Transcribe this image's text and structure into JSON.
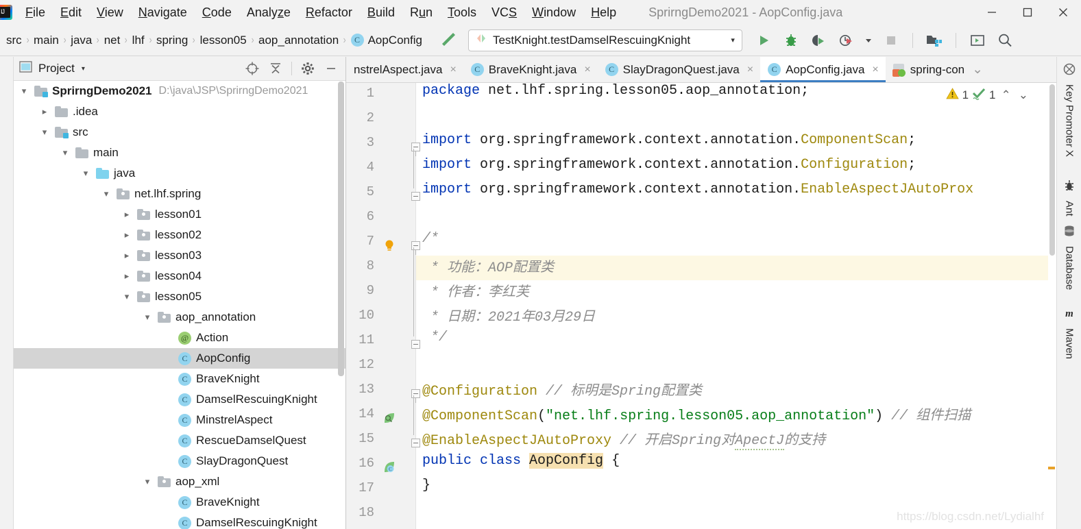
{
  "window": {
    "title": "SprirngDemo2021 - AopConfig.java",
    "controls": {
      "minimize": "minimize-icon",
      "maximize": "maximize-icon",
      "close": "close-icon"
    }
  },
  "menubar": {
    "items": [
      {
        "label": "File",
        "mnemonic": "F"
      },
      {
        "label": "Edit",
        "mnemonic": "E"
      },
      {
        "label": "View",
        "mnemonic": "V"
      },
      {
        "label": "Navigate",
        "mnemonic": "N"
      },
      {
        "label": "Code",
        "mnemonic": "C"
      },
      {
        "label": "Analyze",
        "mnemonic": "z"
      },
      {
        "label": "Refactor",
        "mnemonic": "R"
      },
      {
        "label": "Build",
        "mnemonic": "B"
      },
      {
        "label": "Run",
        "mnemonic": "u"
      },
      {
        "label": "Tools",
        "mnemonic": "T"
      },
      {
        "label": "VCS",
        "mnemonic": "S"
      },
      {
        "label": "Window",
        "mnemonic": "W"
      },
      {
        "label": "Help",
        "mnemonic": "H"
      }
    ]
  },
  "navbar": {
    "breadcrumbs": [
      "src",
      "main",
      "java",
      "net",
      "lhf",
      "spring",
      "lesson05",
      "aop_annotation"
    ],
    "breadcrumb_final": "AopConfig",
    "breadcrumb_final_icon": "class-icon",
    "separator": "›",
    "make_project_icon": "hammer-icon",
    "run_config": {
      "label": "TestKnight.testDamselRescuingKnight",
      "icon": "run-config-icon",
      "caret": "▾"
    },
    "toolbar_buttons": [
      {
        "name": "run-button",
        "icon": "play-icon"
      },
      {
        "name": "debug-button",
        "icon": "bug-icon"
      },
      {
        "name": "run-with-coverage-button",
        "icon": "coverage-icon"
      },
      {
        "name": "profiler-button",
        "icon": "profiler-icon"
      },
      {
        "name": "stop-button",
        "icon": "stop-icon"
      },
      {
        "name": "project-structure-button",
        "icon": "project-structure-icon"
      },
      {
        "name": "terminal-button",
        "icon": "terminal-icon"
      },
      {
        "name": "search-everywhere-button",
        "icon": "search-icon"
      }
    ]
  },
  "project_panel": {
    "title": "Project",
    "caret": "▾",
    "tools": [
      {
        "name": "select-opened-file-button",
        "icon": "target-icon"
      },
      {
        "name": "collapse-all-button",
        "icon": "collapse-all-icon"
      },
      {
        "name": "settings-button",
        "icon": "gear-icon"
      },
      {
        "name": "hide-button",
        "icon": "minimize-icon"
      }
    ],
    "tree": [
      {
        "indent": 0,
        "arrow": "down",
        "icon": "module-folder",
        "label": "SprirngDemo2021",
        "bold": true,
        "hint": "D:\\java\\JSP\\SprirngDemo2021"
      },
      {
        "indent": 1,
        "arrow": "right",
        "icon": "folder",
        "label": ".idea"
      },
      {
        "indent": 1,
        "arrow": "down",
        "icon": "source-folder",
        "label": "src"
      },
      {
        "indent": 2,
        "arrow": "down",
        "icon": "folder",
        "label": "main"
      },
      {
        "indent": 3,
        "arrow": "down",
        "icon": "java-folder",
        "label": "java"
      },
      {
        "indent": 4,
        "arrow": "down",
        "icon": "package",
        "label": "net.lhf.spring"
      },
      {
        "indent": 5,
        "arrow": "right",
        "icon": "package",
        "label": "lesson01"
      },
      {
        "indent": 5,
        "arrow": "right",
        "icon": "package",
        "label": "lesson02"
      },
      {
        "indent": 5,
        "arrow": "right",
        "icon": "package",
        "label": "lesson03"
      },
      {
        "indent": 5,
        "arrow": "right",
        "icon": "package",
        "label": "lesson04"
      },
      {
        "indent": 5,
        "arrow": "down",
        "icon": "package",
        "label": "lesson05"
      },
      {
        "indent": 6,
        "arrow": "down",
        "icon": "package",
        "label": "aop_annotation"
      },
      {
        "indent": 7,
        "arrow": "none",
        "icon": "annotation",
        "label": "Action"
      },
      {
        "indent": 7,
        "arrow": "none",
        "icon": "class",
        "label": "AopConfig",
        "selected": true
      },
      {
        "indent": 7,
        "arrow": "none",
        "icon": "class",
        "label": "BraveKnight"
      },
      {
        "indent": 7,
        "arrow": "none",
        "icon": "class",
        "label": "DamselRescuingKnight"
      },
      {
        "indent": 7,
        "arrow": "none",
        "icon": "class",
        "label": "MinstrelAspect"
      },
      {
        "indent": 7,
        "arrow": "none",
        "icon": "class",
        "label": "RescueDamselQuest"
      },
      {
        "indent": 7,
        "arrow": "none",
        "icon": "class",
        "label": "SlayDragonQuest"
      },
      {
        "indent": 6,
        "arrow": "down",
        "icon": "package",
        "label": "aop_xml"
      },
      {
        "indent": 7,
        "arrow": "none",
        "icon": "class",
        "label": "BraveKnight"
      },
      {
        "indent": 7,
        "arrow": "none",
        "icon": "class",
        "label": "DamselRescuingKnight"
      }
    ]
  },
  "editor": {
    "tabs": [
      {
        "label": "nstrelAspect.java",
        "icon": "class-icon",
        "active": false,
        "truncated_left": true,
        "close": "×"
      },
      {
        "label": "BraveKnight.java",
        "icon": "class-icon",
        "active": false,
        "close": "×"
      },
      {
        "label": "SlayDragonQuest.java",
        "icon": "class-icon",
        "active": false,
        "close": "×"
      },
      {
        "label": "AopConfig.java",
        "icon": "class-icon",
        "active": true,
        "close": "×"
      },
      {
        "label": "spring-con",
        "icon": "spring-xml-icon",
        "active": false,
        "overflow_caret": "⌄"
      }
    ],
    "inspections": {
      "warning_icon": "warning-triangle-icon",
      "warning_count": "1",
      "ok_icon": "inspection-ok-icon",
      "ok_count": "1",
      "prev_icon": "⌃",
      "next_icon": "⌄"
    },
    "watermark": "https://blog.csdn.net/Lydialhf",
    "lines": [
      {
        "no": "1",
        "segments": [
          {
            "t": "package ",
            "c": "kw"
          },
          {
            "t": "net.lhf.spring.lesson05.aop_annotation;",
            "c": ""
          }
        ]
      },
      {
        "no": "2",
        "segments": []
      },
      {
        "no": "3",
        "fold": "top",
        "segments": [
          {
            "t": "import ",
            "c": "kw"
          },
          {
            "t": "org.springframework.context.annotation.",
            "c": ""
          },
          {
            "t": "ComponentScan",
            "c": "cls-ref"
          },
          {
            "t": ";",
            "c": ""
          }
        ]
      },
      {
        "no": "4",
        "segments": [
          {
            "t": "import ",
            "c": "kw"
          },
          {
            "t": "org.springframework.context.annotation.",
            "c": ""
          },
          {
            "t": "Configuration",
            "c": "cls-ref"
          },
          {
            "t": ";",
            "c": ""
          }
        ]
      },
      {
        "no": "5",
        "fold": "bottom",
        "segments": [
          {
            "t": "import ",
            "c": "kw"
          },
          {
            "t": "org.springframework.context.annotation.",
            "c": ""
          },
          {
            "t": "EnableAspectJAutoProx",
            "c": "cls-ref"
          }
        ]
      },
      {
        "no": "6",
        "segments": []
      },
      {
        "no": "7",
        "fold": "top",
        "gutter_icon": "lightbulb-icon",
        "segments": [
          {
            "t": "/",
            "c": "cmt"
          },
          {
            "t": "*",
            "c": "cmt"
          }
        ]
      },
      {
        "no": "8",
        "highlight": true,
        "segments": [
          {
            "t": " * 功能：AOP配置类",
            "c": "cmt"
          }
        ]
      },
      {
        "no": "9",
        "segments": [
          {
            "t": " * 作者：李红芙",
            "c": "cmt"
          }
        ]
      },
      {
        "no": "10",
        "segments": [
          {
            "t": " * 日期：2021年03月29日",
            "c": "cmt"
          }
        ]
      },
      {
        "no": "11",
        "fold": "bottom",
        "segments": [
          {
            "t": " */",
            "c": "cmt"
          }
        ]
      },
      {
        "no": "12",
        "segments": []
      },
      {
        "no": "13",
        "fold": "top",
        "segments": [
          {
            "t": "@Configuration",
            "c": "ann"
          },
          {
            "t": " // ",
            "c": "cmt"
          },
          {
            "t": "标明是Spring配置类",
            "c": "cmt"
          }
        ]
      },
      {
        "no": "14",
        "gutter_icon": "bean-icon",
        "segments": [
          {
            "t": "@ComponentScan",
            "c": "ann"
          },
          {
            "t": "(",
            "c": ""
          },
          {
            "t": "\"net.lhf.spring.lesson05.aop_annotation\"",
            "c": "str"
          },
          {
            "t": ")",
            "c": ""
          },
          {
            "t": " // ",
            "c": "cmt"
          },
          {
            "t": "组件扫描",
            "c": "cmt"
          }
        ]
      },
      {
        "no": "15",
        "fold": "bottom",
        "segments": [
          {
            "t": "@EnableAspectJAutoProxy",
            "c": "ann"
          },
          {
            "t": " // ",
            "c": "cmt"
          },
          {
            "t": "开启Spring对",
            "c": "cmt"
          },
          {
            "t": "ApectJ",
            "c": "cmt squig"
          },
          {
            "t": "的支持",
            "c": "cmt"
          }
        ]
      },
      {
        "no": "16",
        "gutter_icon": "spring-bean-icon",
        "segments": [
          {
            "t": "public class ",
            "c": "kw"
          },
          {
            "t": "AopConfig",
            "c": "hl-ident"
          },
          {
            "t": " {",
            "c": ""
          }
        ]
      },
      {
        "no": "17",
        "segments": [
          {
            "t": "}",
            "c": ""
          }
        ]
      },
      {
        "no": "18",
        "segments": []
      }
    ]
  },
  "right_tool_window": {
    "tabs": [
      {
        "label": "Key Promoter X",
        "icon": "key-promoter-icon"
      },
      {
        "label": "Ant",
        "icon": "ant-icon"
      },
      {
        "label": "Database",
        "icon": "database-icon"
      },
      {
        "label": "Maven",
        "icon": "maven-icon"
      }
    ]
  },
  "colors": {
    "accent_blue": "#3c7ec2",
    "keyword": "#0033b3",
    "string": "#067d17",
    "annotation": "#9e880d",
    "comment": "#8c8c8c",
    "selection_gray": "#d4d4d4",
    "caret_row": "#fdf8e3"
  }
}
